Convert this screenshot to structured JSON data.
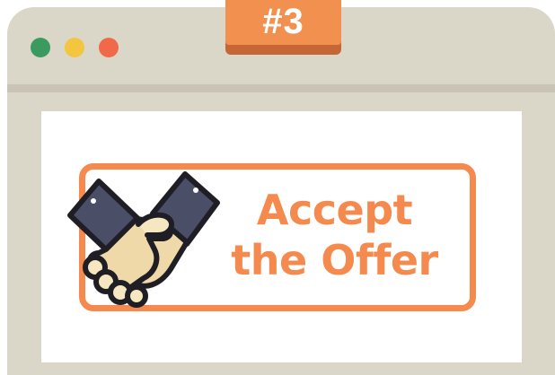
{
  "window": {
    "controls": [
      "close",
      "minimize",
      "maximize"
    ],
    "colors": {
      "green": "#3a9a60",
      "yellow": "#f4c53f",
      "red": "#f06a4a",
      "frame": "#dad6c8"
    }
  },
  "badge": {
    "label": "#3",
    "color": "#f2914f"
  },
  "offer": {
    "line1": "Accept",
    "line2": "the Offer",
    "accent": "#f58a4e",
    "icon": "handshake-icon"
  }
}
